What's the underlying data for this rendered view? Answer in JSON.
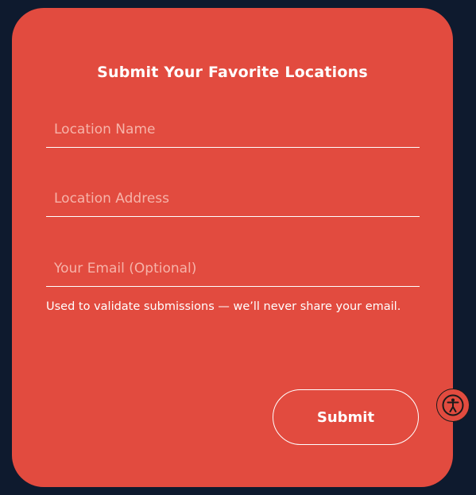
{
  "form": {
    "title": "Submit Your Favorite Locations",
    "location_name": {
      "placeholder": "Location Name",
      "value": ""
    },
    "location_address": {
      "placeholder": "Location Address",
      "value": ""
    },
    "email": {
      "placeholder": "Your Email (Optional)",
      "value": ""
    },
    "helper_text": "Used to validate submissions — we’ll never share your email.",
    "submit_label": "Submit"
  },
  "accessibility": {
    "icon": "accessibility-icon"
  },
  "colors": {
    "background": "#0e1a2e",
    "card": "#e24b3f",
    "text": "#ffffff",
    "placeholder": "#f6b3a9"
  }
}
